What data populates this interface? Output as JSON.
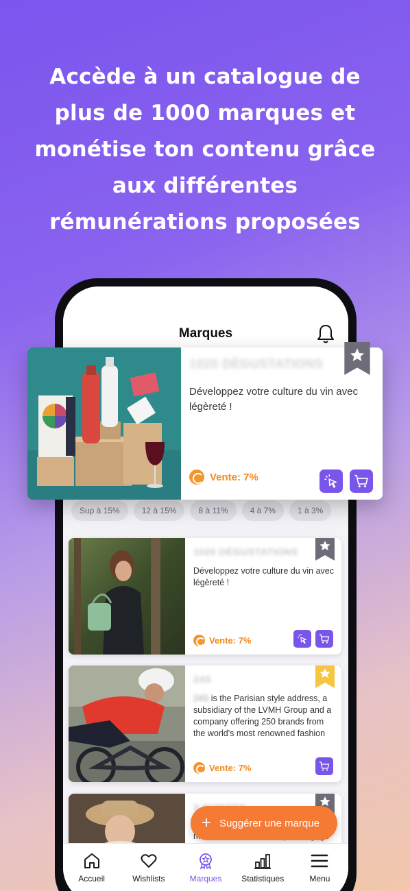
{
  "headline": "Accède à un catalogue de plus de 1000 marques et monétise ton contenu grâce aux différentes rémunérations proposées",
  "header": {
    "title": "Marques",
    "icon": "bell-icon"
  },
  "filters": [
    "Sup à 15%",
    "12 à 15%",
    "8 à 11%",
    "4 à 7%",
    "1 à 3%"
  ],
  "featured": {
    "brand": "1020 DÉGUSTATIONS",
    "description": "Développez votre culture du vin avec légèreté !",
    "sale": "Vente: 7%",
    "bookmark_color": "#6d6c78"
  },
  "cards": [
    {
      "brand": "1020 DÉGUSTATIONS",
      "description": "Développez votre culture du vin avec légèreté !",
      "sale": "Vente: 7%",
      "bookmark_color": "#6d6c78"
    },
    {
      "brand": "24S",
      "description_blur": "24S",
      "description": " is the Parisian style address, a subsidiary of the LVMH Group and a company offering 250 brands from the world's most renowned fashion",
      "sale": "Vente: 7%",
      "bookmark_color": "#f7c541"
    },
    {
      "brand": "3 SUISSES",
      "description": "mode et de décoration qui s'engage",
      "bookmark_color": "#6d6c78"
    }
  ],
  "fab": {
    "label": "Suggérer une marque"
  },
  "tabs": [
    {
      "label": "Accueil",
      "icon": "home-icon"
    },
    {
      "label": "Wishlists",
      "icon": "heart-icon"
    },
    {
      "label": "Marques",
      "icon": "badge-icon",
      "active": true
    },
    {
      "label": "Statistiques",
      "icon": "bar-chart-icon"
    },
    {
      "label": "Menu",
      "icon": "menu-icon"
    }
  ],
  "colors": {
    "accent": "#7a55ea",
    "orange": "#f57a34",
    "sale": "#f08a1e"
  }
}
